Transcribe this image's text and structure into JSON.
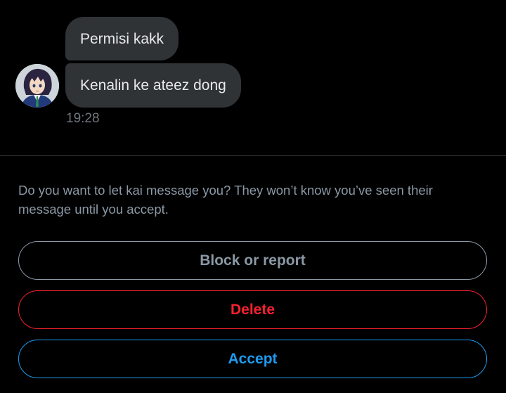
{
  "conversation": {
    "messages": [
      {
        "text": "Permisi kakk"
      },
      {
        "text": "Kenalin ke ateez dong"
      }
    ],
    "timestamp": "19:28",
    "avatar_icon": "anime-character-avatar"
  },
  "request": {
    "prompt": "Do you want to let kai message you? They won’t know you’ve seen their message until you accept.",
    "block_label": "Block or report",
    "delete_label": "Delete",
    "accept_label": "Accept"
  },
  "colors": {
    "background": "#000000",
    "bubble": "#2f3336",
    "muted_text": "#8b98a5",
    "danger": "#f4212e",
    "accent": "#1d9bf0"
  }
}
